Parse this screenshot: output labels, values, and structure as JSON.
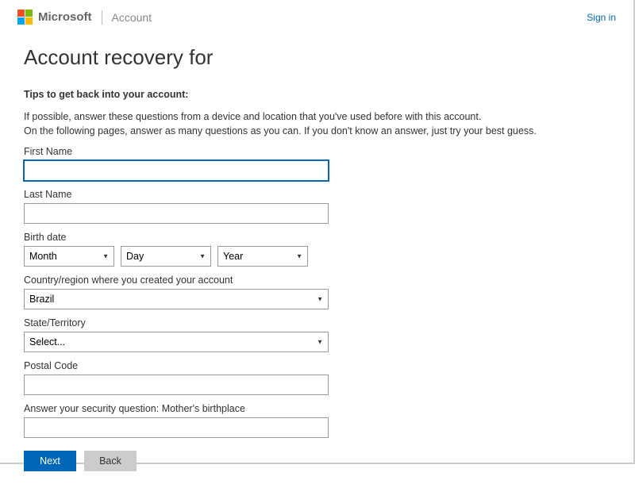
{
  "header": {
    "brand": "Microsoft",
    "section": "Account",
    "signin": "Sign in"
  },
  "page": {
    "title": "Account recovery for",
    "tips_heading": "Tips to get back into your account:",
    "tips_line1": "If possible, answer these questions from a device and location that you've used before with this account.",
    "tips_line2": "On the following pages, answer as many questions as you can. If you don't know an answer, just try your best guess."
  },
  "form": {
    "first_name_label": "First Name",
    "first_name_value": "",
    "last_name_label": "Last Name",
    "last_name_value": "",
    "birth_label": "Birth date",
    "birth_month": "Month",
    "birth_day": "Day",
    "birth_year": "Year",
    "country_label": "Country/region where you created your account",
    "country_value": "Brazil",
    "state_label": "State/Territory",
    "state_value": "Select...",
    "postal_label": "Postal Code",
    "postal_value": "",
    "security_label": "Answer your security question: Mother's birthplace",
    "security_value": ""
  },
  "buttons": {
    "next": "Next",
    "back": "Back"
  }
}
